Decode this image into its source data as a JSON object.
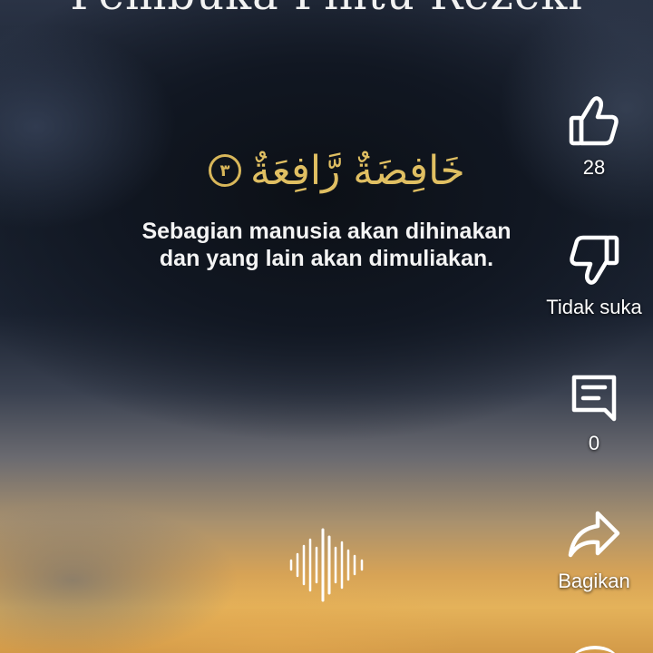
{
  "video": {
    "title_partial": "Pembuka Pintu Rezeki",
    "arabic_verse": "خَافِضَةٌ رَّافِعَةٌ",
    "ayah_number": "٣",
    "translation": {
      "line1": "Sebagian manusia akan dihinakan",
      "line2": "dan yang lain akan dimuliakan."
    }
  },
  "actions": {
    "like": {
      "icon": "thumbs-up-icon",
      "label": "28"
    },
    "dislike": {
      "icon": "thumbs-down-icon",
      "label": "Tidak suka"
    },
    "comment": {
      "icon": "comment-icon",
      "label": "0"
    },
    "share": {
      "icon": "share-icon",
      "label": "Bagikan"
    }
  },
  "colors": {
    "arabic_gold": "#e0bf62",
    "icon_white": "#ffffff"
  }
}
